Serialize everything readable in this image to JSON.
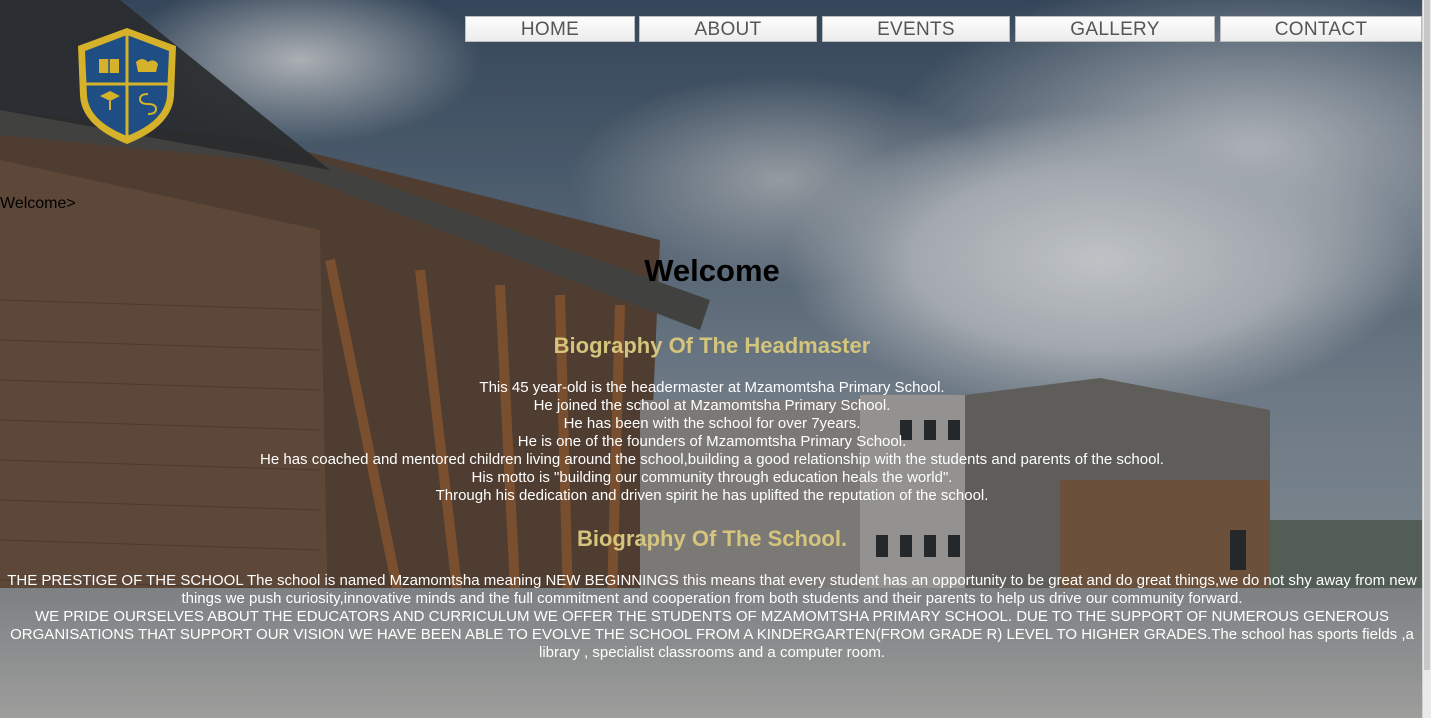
{
  "nav": {
    "items": [
      "HOME",
      "ABOUT",
      "EVENTS",
      "GALLERY",
      "CONTACT"
    ]
  },
  "breadcrumb": "Welcome>",
  "welcome_title": "Welcome",
  "headmaster": {
    "title": "Biography Of The Headmaster",
    "lines": [
      "This 45 year-old is the headermaster at Mzamomtsha Primary School.",
      "He joined the school at Mzamomtsha Primary School.",
      "He has been with the school for over 7years.",
      "He is one of the founders of Mzamomtsha Primary School.",
      "He has coached and mentored children living around the school,building a good relationship with the students and parents of the school.",
      "His motto is \"building our community through education heals the world\".",
      "Through his dedication and driven spirit he has uplifted the reputation of the school."
    ]
  },
  "school": {
    "title": "Biography Of The School.",
    "paragraph1": "THE PRESTIGE OF THE SCHOOL The school is named Mzamomtsha meaning NEW BEGINNINGS this means that every student has an opportunity to be great and do great things,we do not shy away from new things we push curiosity,innovative minds and the full commitment and cooperation from both students and their parents to help us drive our community forward.",
    "paragraph2": "WE PRIDE OURSELVES ABOUT THE EDUCATORS AND CURRICULUM WE OFFER THE STUDENTS OF MZAMOMTSHA PRIMARY SCHOOL. DUE TO THE SUPPORT OF NUMEROUS GENEROUS ORGANISATIONS THAT SUPPORT OUR VISION WE HAVE BEEN ABLE TO EVOLVE THE SCHOOL FROM A KINDERGARTEN(FROM GRADE R) LEVEL TO HIGHER GRADES.The school has sports fields ,a library , specialist classrooms and a computer room."
  },
  "colors": {
    "heading_gold": "#d4c47c",
    "crest_blue": "#1f4e85",
    "crest_gold": "#d6b22a"
  }
}
